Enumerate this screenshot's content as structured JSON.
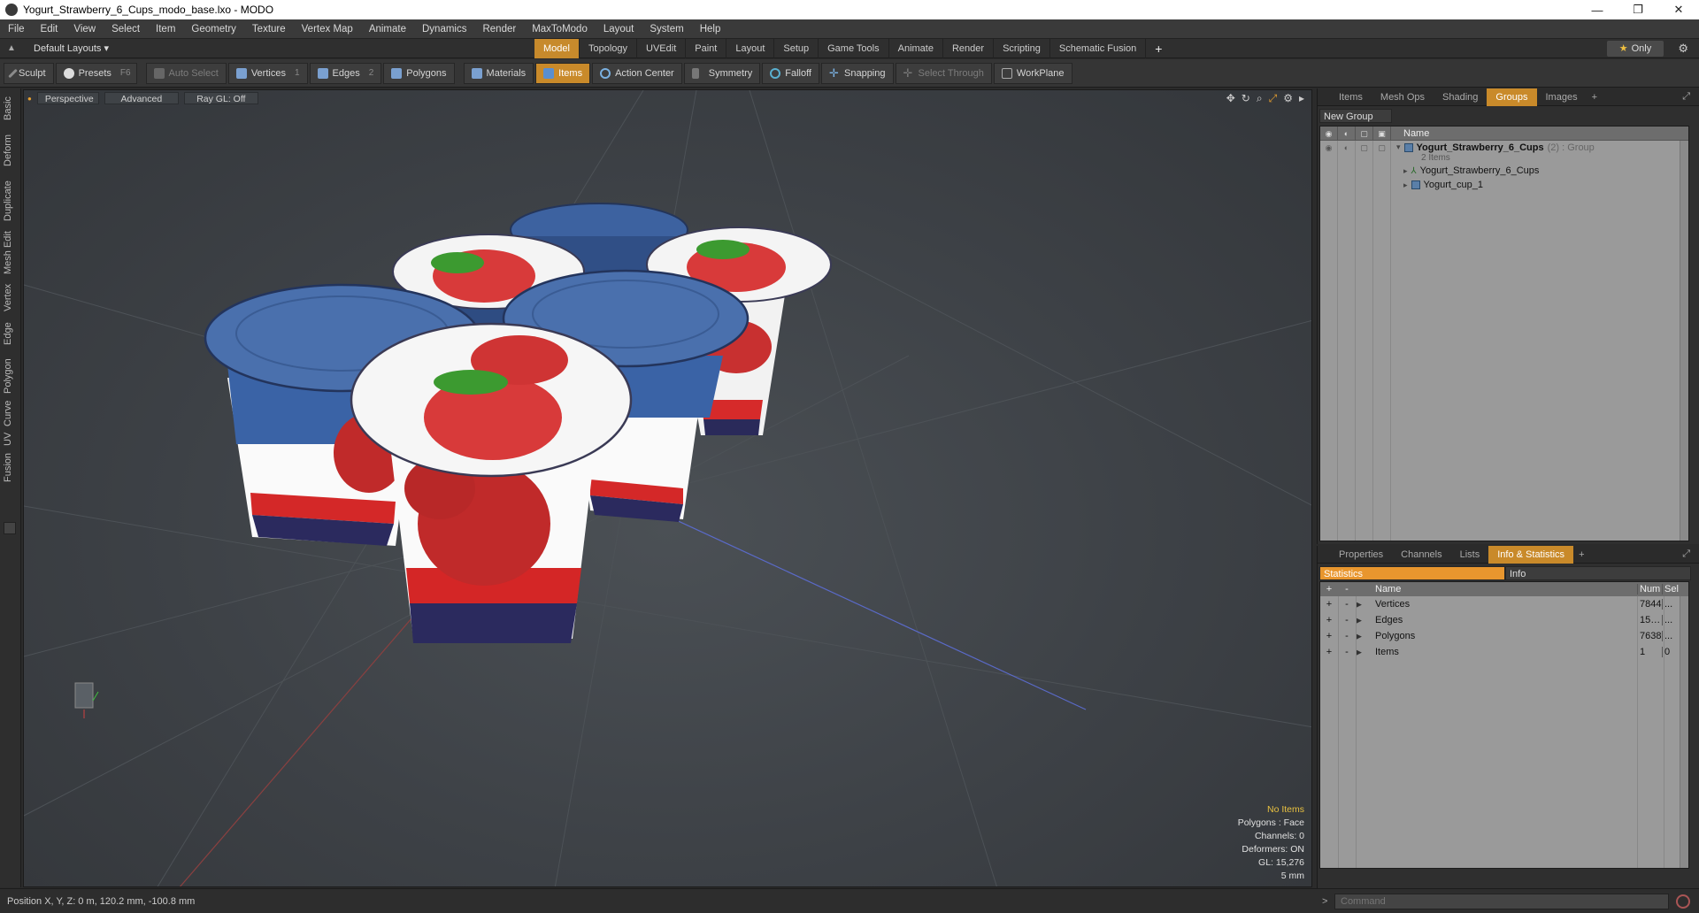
{
  "window": {
    "title": "Yogurt_Strawberry_6_Cups_modo_base.lxo - MODO",
    "controls": [
      "—",
      "❐",
      "✕"
    ]
  },
  "menu": [
    "File",
    "Edit",
    "View",
    "Select",
    "Item",
    "Geometry",
    "Texture",
    "Vertex Map",
    "Animate",
    "Dynamics",
    "Render",
    "MaxToModo",
    "Layout",
    "System",
    "Help"
  ],
  "layoutbar": {
    "layouts_label": "Default Layouts ▾",
    "tabs": [
      "Model",
      "Topology",
      "UVEdit",
      "Paint",
      "Layout",
      "Setup",
      "Game Tools",
      "Animate",
      "Render",
      "Scripting",
      "Schematic Fusion"
    ],
    "active_tab": "Model",
    "only_label": "Only"
  },
  "toolbar": {
    "sculpt": "Sculpt",
    "presets": "Presets",
    "presets_key": "F6",
    "auto_select": "Auto Select",
    "vertices": "Vertices",
    "vertices_count": "1",
    "edges": "Edges",
    "edges_count": "2",
    "polygons": "Polygons",
    "materials": "Materials",
    "items": "Items",
    "action_center": "Action Center",
    "symmetry": "Symmetry",
    "falloff": "Falloff",
    "snapping": "Snapping",
    "select_through": "Select Through",
    "workplane": "WorkPlane"
  },
  "left_rail": [
    "Basic",
    "Deform",
    "Duplicate",
    "Mesh Edit",
    "Vertex",
    "Edge",
    "Polygon",
    "Curve",
    "UV",
    "Fusion"
  ],
  "viewport": {
    "view": "Perspective",
    "shading": "Advanced",
    "raygl": "Ray GL: Off",
    "info": {
      "no_items": "No Items",
      "polygons": "Polygons : Face",
      "channels": "Channels: 0",
      "deformers": "Deformers: ON",
      "gl": "GL: 15,276",
      "scale": "5 mm"
    }
  },
  "status": {
    "position": "Position X, Y, Z:  0 m, 120.2 mm, -100.8 mm"
  },
  "groups_panel": {
    "tabs": [
      "Items",
      "Mesh Ops",
      "Shading",
      "Groups",
      "Images"
    ],
    "active_tab": "Groups",
    "new_group": "New Group",
    "column_name": "Name",
    "rows": [
      {
        "name": "Yogurt_Strawberry_6_Cups",
        "meta": "(2) : Group",
        "sub": "2 Items"
      },
      {
        "name": "Yogurt_Strawberry_6_Cups"
      },
      {
        "name": "Yogurt_cup_1"
      }
    ]
  },
  "stats_panel": {
    "tabs": [
      "Properties",
      "Channels",
      "Lists",
      "Info & Statistics"
    ],
    "active_tab": "Info & Statistics",
    "subtabs": [
      "Statistics",
      "Info"
    ],
    "columns": {
      "name": "Name",
      "num": "Num",
      "sel": "Sel"
    },
    "rows": [
      {
        "name": "Vertices",
        "num": "7844",
        "sel": "..."
      },
      {
        "name": "Edges",
        "num": "15…",
        "sel": "..."
      },
      {
        "name": "Polygons",
        "num": "7638",
        "sel": "..."
      },
      {
        "name": "Items",
        "num": "1",
        "sel": "0"
      }
    ]
  },
  "command": {
    "placeholder": "Command"
  }
}
